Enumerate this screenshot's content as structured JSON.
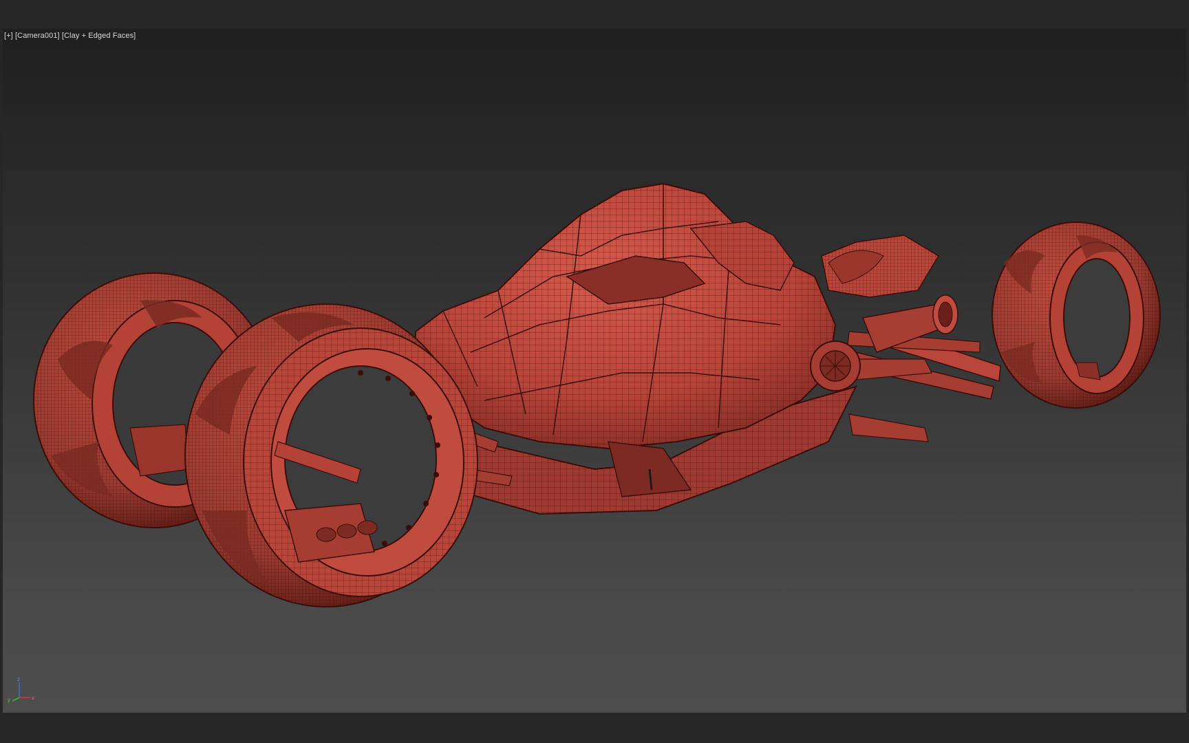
{
  "viewport": {
    "menu_label": "[+]",
    "camera_label": "[Camera001]",
    "shading_label": "[Clay + Edged Faces]"
  },
  "axis_gizmo": {
    "z_label": "z",
    "x_label": "x",
    "y_label": "y"
  },
  "colors": {
    "clay": "#c0473c",
    "clay_dark": "#5a1a14",
    "wire": "#3a0d08",
    "bg_top": "#1f1f1f",
    "bg_bottom": "#4d4d4d",
    "axis_x": "#d23c3c",
    "axis_y": "#3cc23c",
    "axis_z": "#3c6ed2"
  },
  "icons": [
    "axis-gizmo-icon"
  ]
}
